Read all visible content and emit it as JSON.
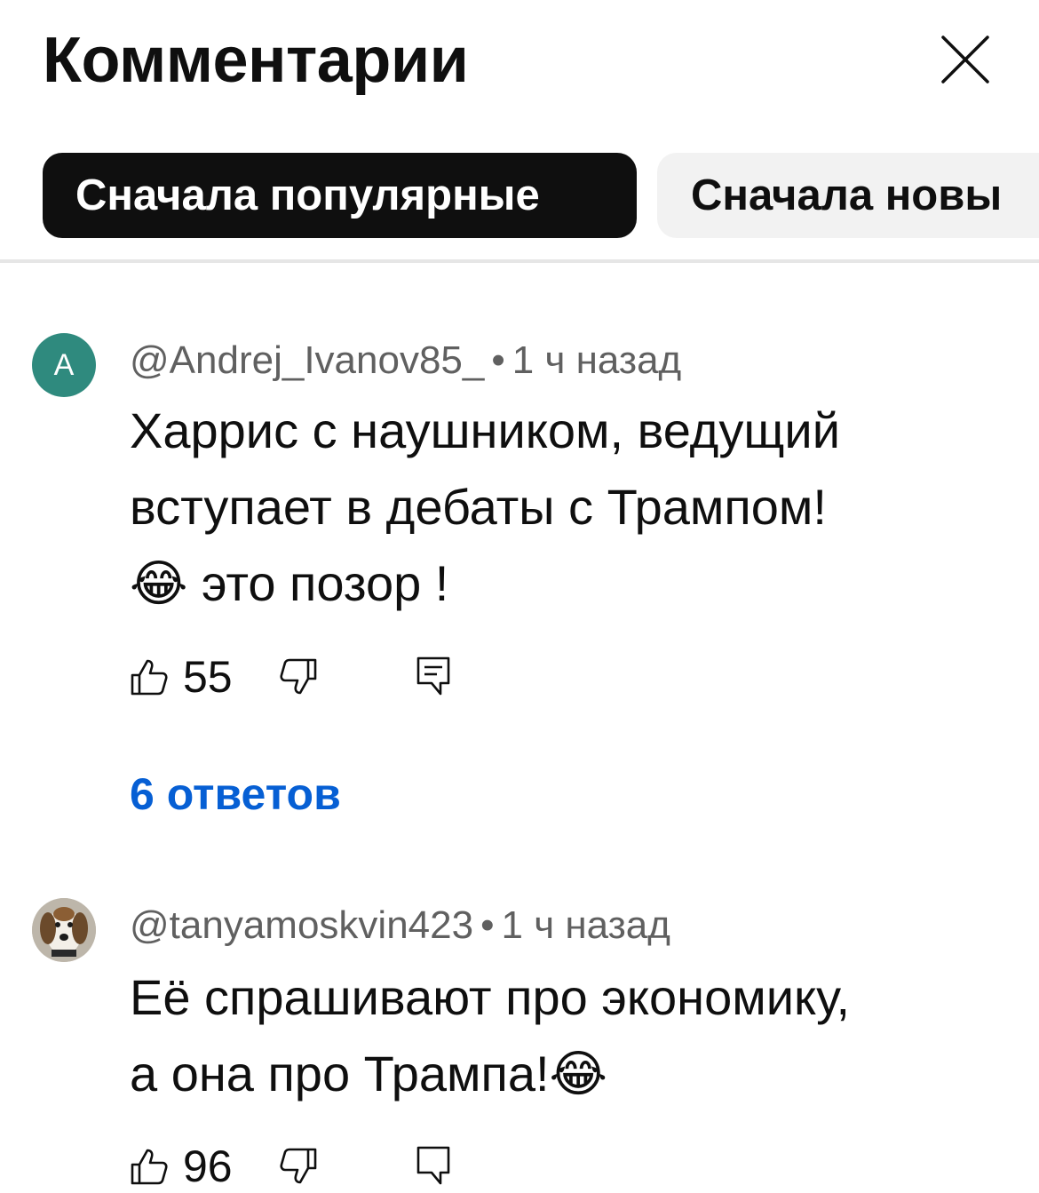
{
  "header": {
    "title": "Комментарии",
    "close_icon": "close-icon"
  },
  "sort_chips": [
    {
      "label": "Сначала популярные",
      "selected": true
    },
    {
      "label": "Сначала новы",
      "selected": false
    }
  ],
  "comments": [
    {
      "author": "@Andrej_Ivanov85_",
      "avatar_letter": "A",
      "avatar_color": "#2f8a7e",
      "time": "1 ч назад",
      "text_lines": [
        "Харрис с наушником, ведущий",
        "вступает в дебаты с Трампом!",
        "😂 это позор !"
      ],
      "likes": "55",
      "replies_label": "6 ответов"
    },
    {
      "author": "@tanyamoskvin423",
      "time": "1 ч назад",
      "text_lines": [
        "Её спрашивают про экономику,",
        "а она про Трампа!😂"
      ],
      "likes": "96"
    }
  ],
  "colors": {
    "accent_link": "#065fd4",
    "chip_active_bg": "#0f0f0f",
    "chip_inactive_bg": "#f2f2f2",
    "meta_text": "#606060"
  }
}
